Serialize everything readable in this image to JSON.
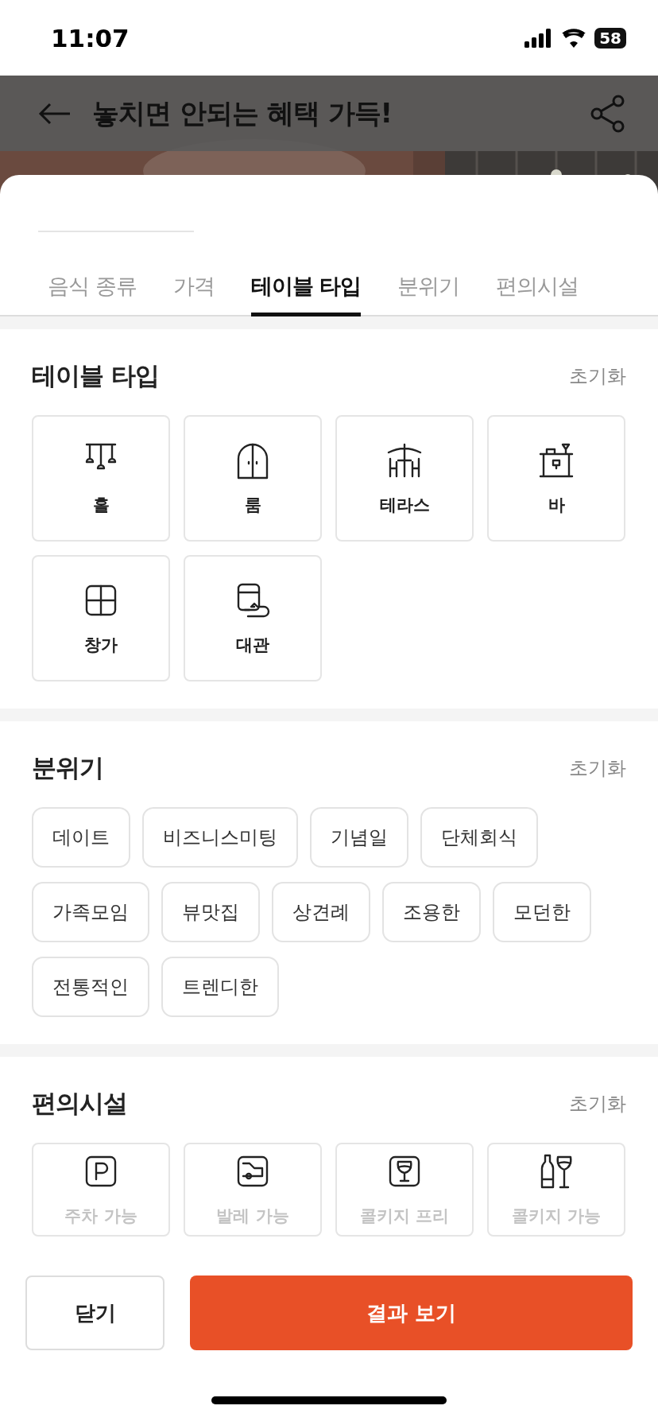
{
  "status_bar": {
    "time": "11:07",
    "battery": "58"
  },
  "header": {
    "title": "놓치면 안되는 혜택 가득!"
  },
  "tabs": [
    {
      "label": "음식 종류",
      "selected": false
    },
    {
      "label": "가격",
      "selected": false
    },
    {
      "label": "테이블 타입",
      "selected": true
    },
    {
      "label": "분위기",
      "selected": false
    },
    {
      "label": "편의시설",
      "selected": false
    }
  ],
  "table_type": {
    "title": "테이블 타입",
    "reset": "초기화",
    "options": [
      {
        "label": "홀",
        "kind": "hall",
        "selected": false
      },
      {
        "label": "룸",
        "kind": "room",
        "selected": false
      },
      {
        "label": "테라스",
        "kind": "terrace",
        "selected": false
      },
      {
        "label": "바",
        "kind": "bar",
        "selected": false
      },
      {
        "label": "창가",
        "kind": "window",
        "selected": false
      },
      {
        "label": "대관",
        "kind": "rental",
        "selected": false
      }
    ]
  },
  "mood": {
    "title": "분위기",
    "reset": "초기화",
    "options": [
      {
        "label": "데이트",
        "selected": false
      },
      {
        "label": "비즈니스미팅",
        "selected": false
      },
      {
        "label": "기념일",
        "selected": false
      },
      {
        "label": "단체회식",
        "selected": false
      },
      {
        "label": "가족모임",
        "selected": false
      },
      {
        "label": "뷰맛집",
        "selected": false
      },
      {
        "label": "상견례",
        "selected": false
      },
      {
        "label": "조용한",
        "selected": false
      },
      {
        "label": "모던한",
        "selected": false
      },
      {
        "label": "전통적인",
        "selected": false
      },
      {
        "label": "트렌디한",
        "selected": false
      }
    ]
  },
  "facilities": {
    "title": "편의시설",
    "reset": "초기화",
    "options": [
      {
        "label": "주차 가능",
        "kind": "parking",
        "selected": false
      },
      {
        "label": "발레 가능",
        "kind": "valet",
        "selected": false
      },
      {
        "label": "콜키지 프리",
        "kind": "corkage-free",
        "selected": false
      },
      {
        "label": "콜키지 가능",
        "kind": "corkage",
        "selected": false
      }
    ]
  },
  "footer": {
    "close": "닫기",
    "submit": "결과 보기"
  }
}
